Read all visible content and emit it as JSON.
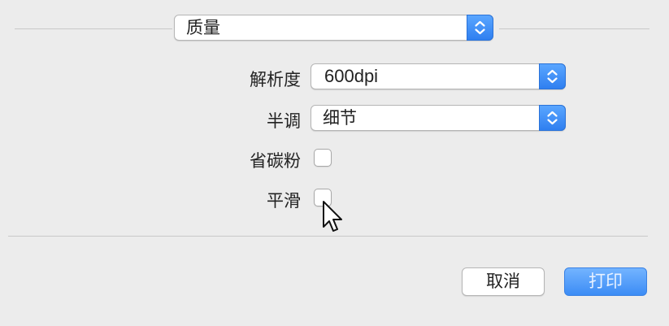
{
  "section": {
    "popup_value": "质量"
  },
  "settings": {
    "resolution": {
      "label": "解析度",
      "value": "600dpi"
    },
    "halftone": {
      "label": "半调",
      "value": "细节"
    },
    "toner_save": {
      "label": "省碳粉",
      "checked": false
    },
    "smoothing": {
      "label": "平滑",
      "checked": false
    }
  },
  "buttons": {
    "cancel": "取消",
    "print": "打印"
  },
  "colors": {
    "accent": "#3c8cf5",
    "background": "#ececec"
  },
  "icons": {
    "stepper": "up-down-chevron-icon",
    "cursor": "mouse-pointer-icon"
  }
}
